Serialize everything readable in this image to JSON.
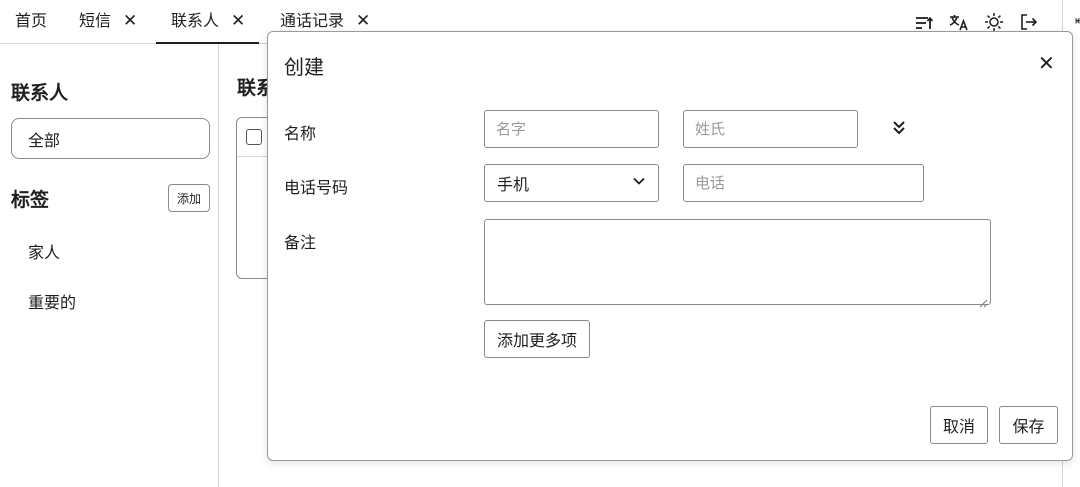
{
  "tabs": [
    {
      "label": "首页",
      "closable": false,
      "active": false
    },
    {
      "label": "短信",
      "closable": true,
      "active": false
    },
    {
      "label": "联系人",
      "closable": true,
      "active": true
    },
    {
      "label": "通话记录",
      "closable": true,
      "active": false
    }
  ],
  "tab_close_glyph": "✕",
  "toolbar_icons": [
    "sort-icon",
    "translate-icon",
    "theme-sun-icon",
    "logout-icon"
  ],
  "sidebar": {
    "title": "联系人",
    "all_label": "全部",
    "tags_title": "标签",
    "add_tag_label": "添加",
    "tags": [
      "家人",
      "重要的"
    ]
  },
  "main": {
    "title": "联系"
  },
  "modal": {
    "title": "创建",
    "close_glyph": "✕",
    "name_label": "名称",
    "first_name_placeholder": "名字",
    "last_name_placeholder": "姓氏",
    "phone_label": "电话号码",
    "phone_type_selected": "手机",
    "phone_placeholder": "电话",
    "note_label": "备注",
    "add_more_label": "添加更多项",
    "cancel_label": "取消",
    "save_label": "保存"
  }
}
